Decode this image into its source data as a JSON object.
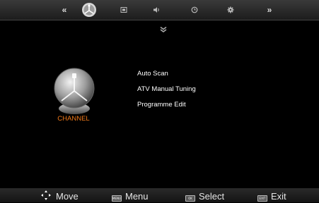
{
  "top_tabs": [
    {
      "icon": "prev-page-icon"
    },
    {
      "icon": "channel-tab-icon",
      "active": true
    },
    {
      "icon": "picture-tab-icon"
    },
    {
      "icon": "sound-tab-icon"
    },
    {
      "icon": "time-tab-icon"
    },
    {
      "icon": "setup-tab-icon"
    },
    {
      "icon": "next-page-icon"
    }
  ],
  "section": {
    "title": "CHANNEL",
    "title_color": "#f27a1a",
    "icon": "satellite-dish-icon"
  },
  "menu": {
    "items": [
      "Auto Scan",
      "ATV Manual Tuning",
      "Programme Edit"
    ],
    "more_indicator": "chevron-double-down-icon"
  },
  "footer": {
    "move": "Move",
    "menu": "Menu",
    "select": "Select",
    "exit": "Exit",
    "menu_key": "MENU",
    "select_key": "OK",
    "exit_key": "EXIT"
  }
}
